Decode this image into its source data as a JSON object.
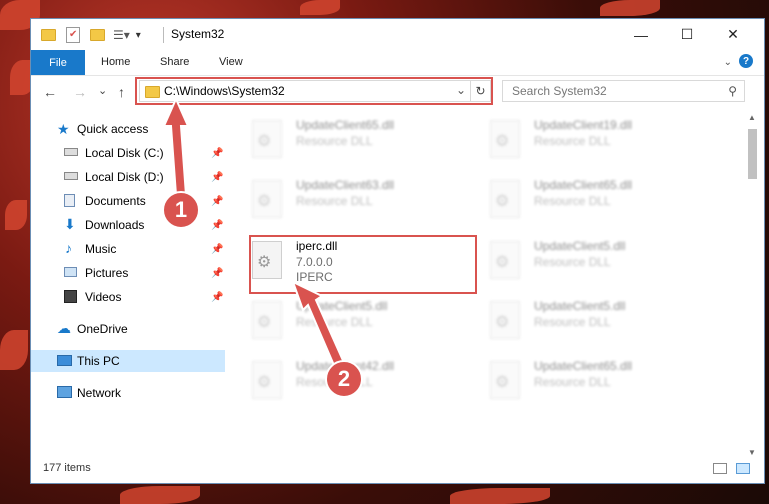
{
  "window": {
    "title": "System32"
  },
  "ribbon": {
    "tabs": [
      "File",
      "Home",
      "Share",
      "View"
    ]
  },
  "controls": {
    "minimize": "—",
    "maximize": "☐",
    "close": "✕",
    "help": "?"
  },
  "nav": {
    "back": "←",
    "forward": "→",
    "recent": "⌄",
    "up": "↑"
  },
  "address": {
    "path": "C:\\Windows\\System32",
    "dropdown": "⌄",
    "refresh": "↻"
  },
  "search": {
    "placeholder": "Search System32"
  },
  "sidebar": {
    "items": [
      {
        "label": "Quick access",
        "icon": "star-icon",
        "pinned": false
      },
      {
        "label": "Local Disk (C:)",
        "icon": "drive-icon",
        "pinned": true
      },
      {
        "label": "Local Disk (D:)",
        "icon": "drive-icon",
        "pinned": true
      },
      {
        "label": "Documents",
        "icon": "documents-icon",
        "pinned": true
      },
      {
        "label": "Downloads",
        "icon": "download-icon",
        "pinned": true
      },
      {
        "label": "Music",
        "icon": "music-icon",
        "pinned": true
      },
      {
        "label": "Pictures",
        "icon": "pictures-icon",
        "pinned": true
      },
      {
        "label": "Videos",
        "icon": "video-icon",
        "pinned": true
      },
      {
        "label": "OneDrive",
        "icon": "cloud-icon",
        "pinned": false
      },
      {
        "label": "This PC",
        "icon": "computer-icon",
        "pinned": false
      },
      {
        "label": "Network",
        "icon": "network-icon",
        "pinned": false
      }
    ]
  },
  "files": [
    {
      "name": "UpdateClient65.dll",
      "sub1": "Resource DLL",
      "sub2": ""
    },
    {
      "name": "UpdateClient19.dll",
      "sub1": "Resource DLL",
      "sub2": ""
    },
    {
      "name": "UpdateClient63.dll",
      "sub1": "Resource DLL",
      "sub2": ""
    },
    {
      "name": "UpdateClient65.dll",
      "sub1": "Resource DLL",
      "sub2": ""
    },
    {
      "name": "iperc.dll",
      "sub1": "7.0.0.0",
      "sub2": "IPERC"
    },
    {
      "name": "UpdateClient5.dll",
      "sub1": "Resource DLL",
      "sub2": ""
    },
    {
      "name": "UpdateClient5.dll",
      "sub1": "Resource DLL",
      "sub2": ""
    },
    {
      "name": "UpdateClient5.dll",
      "sub1": "Resource DLL",
      "sub2": ""
    },
    {
      "name": "UpdateClient42.dll",
      "sub1": "Resource DLL",
      "sub2": ""
    },
    {
      "name": "UpdateClient65.dll",
      "sub1": "Resource DLL",
      "sub2": ""
    }
  ],
  "status": {
    "count": "177 items"
  },
  "callouts": {
    "one": "1",
    "two": "2"
  },
  "colors": {
    "accent": "#1979ca",
    "annotation": "#d9534f",
    "selection": "#cce8ff"
  }
}
